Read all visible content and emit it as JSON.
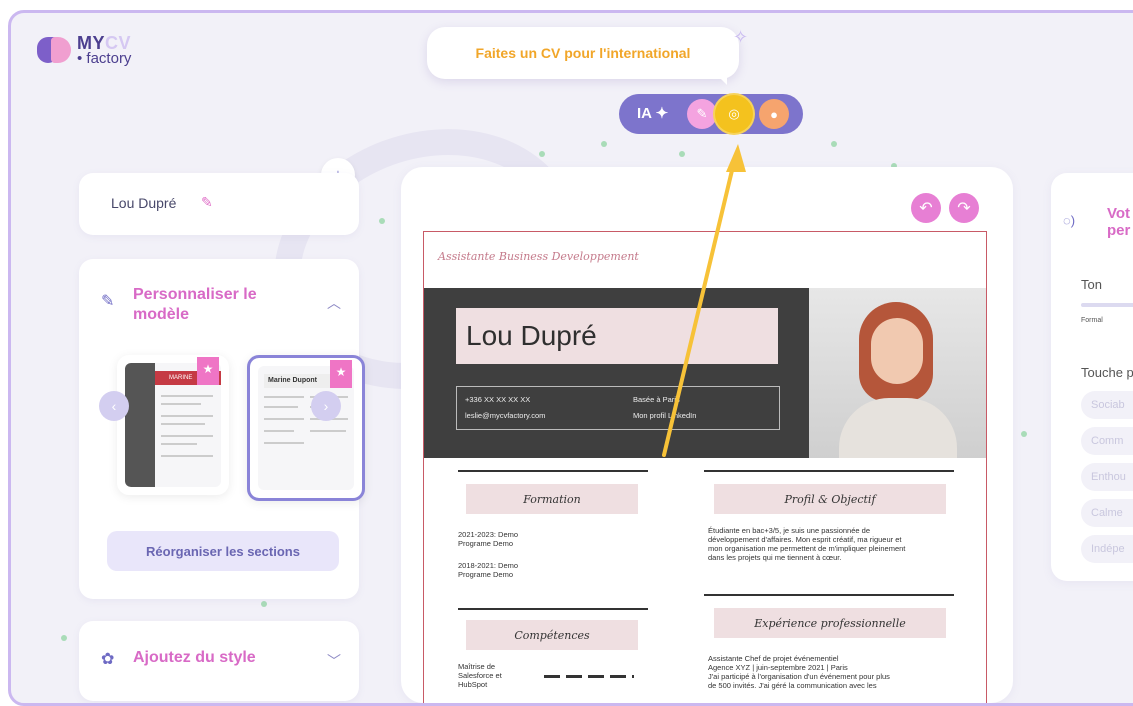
{
  "logo": {
    "brand_my": "MY",
    "brand_cv": "CV",
    "brand_sub": "factory"
  },
  "promo": {
    "bubble_text": "Faites un CV pour l'international"
  },
  "ai_bar": {
    "label": "IA ✦",
    "tools": [
      "magic-wand-icon",
      "globe-translate-icon",
      "microphone-icon"
    ]
  },
  "sidebar": {
    "cv_name": "Lou Dupré",
    "customize_title": "Personnaliser le modèle",
    "template1_header": "MARINE",
    "template2_header": "Marine Dupont",
    "reorganize_label": "Réorganiser les sections",
    "style_title": "Ajoutez du style"
  },
  "cv": {
    "job_title": "Assistante Business Developpement",
    "name": "Lou Dupré",
    "phone": "+336 XX XX XX XX",
    "location": "Basée à Paris",
    "email": "leslie@mycvfactory.com",
    "profile_link": "Mon profil LinkedIn",
    "sections": {
      "education": "Formation",
      "profile": "Profil & Objectif",
      "skills": "Compétences",
      "experience": "Expérience professionnelle"
    },
    "education_items": [
      "2021-2023: Demo",
      "Programe Demo",
      "2018-2021: Demo",
      "Programe Demo"
    ],
    "profile_text": [
      "Étudiante en bac+3/5, je suis une passionnée de",
      "développement d'affaires. Mon esprit créatif, ma rigueur et",
      "mon organisation me permettent de m'impliquer pleinement",
      "dans les projets qui me tiennent à cœur."
    ],
    "skills_text": [
      "Maîtrise de",
      "Salesforce et",
      "HubSpot"
    ],
    "experience_text": [
      "Assistante Chef de projet événementiel",
      "Agence XYZ | juin-septembre 2021 | Paris",
      "J'ai participé à l'organisation d'un événement pour plus",
      "de 500 invités. J'ai géré la communication avec les"
    ]
  },
  "right_panel": {
    "title_line1": "Vot",
    "title_line2": "per",
    "tone_label": "Ton",
    "tone_value": "Formal",
    "touch_label": "Touche p",
    "chips": [
      "Sociab",
      "Comm",
      "Enthou",
      "Calme",
      "Indépe"
    ]
  },
  "colors": {
    "accent_pink": "#d86ac6",
    "accent_purple": "#7d74cc",
    "promo_orange": "#f1a629",
    "arrow_yellow": "#f7c238"
  }
}
